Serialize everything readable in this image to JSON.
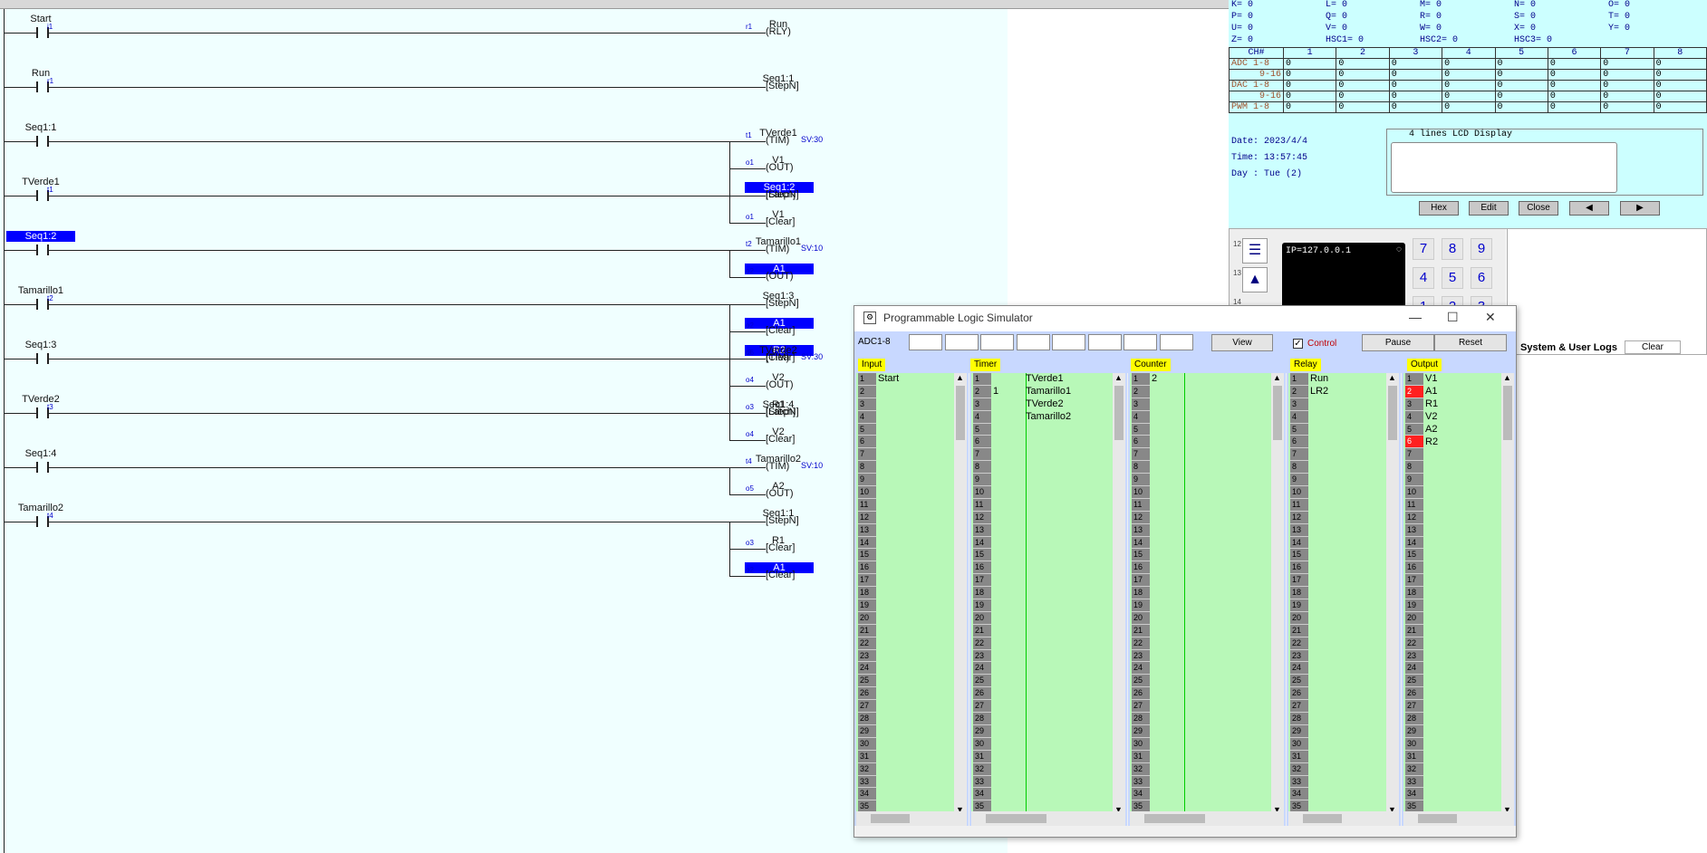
{
  "ladder": {
    "rungs": [
      {
        "contact": "Start",
        "contact_addr": "i1",
        "coils": [
          {
            "label": "Run",
            "addr": "r1",
            "type": "(RLY)"
          }
        ]
      },
      {
        "contact": "Run",
        "contact_addr": "r1",
        "coils": [
          {
            "label": "Seq1:1",
            "addr": "",
            "type": "[StepN]"
          }
        ]
      },
      {
        "contact": "Seq1:1",
        "contact_addr": "",
        "coils": [
          {
            "label": "TVerde1",
            "addr": "t1",
            "type": "(TIM)",
            "sv": "SV:30"
          },
          {
            "label": "V1",
            "addr": "o1",
            "type": "(OUT)"
          },
          {
            "label": "R2",
            "addr": "o6",
            "type": "[Latch]",
            "hl": true
          }
        ]
      },
      {
        "contact": "TVerde1",
        "contact_addr": "t1",
        "coils": [
          {
            "label": "Seq1:2",
            "addr": "",
            "type": "[StepN]",
            "hl": true
          },
          {
            "label": "V1",
            "addr": "o1",
            "type": "[Clear]"
          }
        ]
      },
      {
        "contact": "Seq1:2",
        "contact_addr": "",
        "contact_hl": true,
        "coils": [
          {
            "label": "Tamarillo1",
            "addr": "t2",
            "type": "(TIM)",
            "sv": "SV:10"
          },
          {
            "label": "A1",
            "addr": "o2",
            "type": "(OUT)",
            "hl": true
          }
        ]
      },
      {
        "contact": "Tamarillo1",
        "contact_addr": "t2",
        "coils": [
          {
            "label": "Seq1:3",
            "addr": "",
            "type": "[StepN]"
          },
          {
            "label": "A1",
            "addr": "o2",
            "type": "[Clear]",
            "hl": true
          },
          {
            "label": "R2",
            "addr": "o6",
            "type": "[Clear]",
            "hl": true
          }
        ]
      },
      {
        "contact": "Seq1:3",
        "contact_addr": "",
        "coils": [
          {
            "label": "TVerde2",
            "addr": "t3",
            "type": "(TIM)",
            "sv": "SV:30"
          },
          {
            "label": "V2",
            "addr": "o4",
            "type": "(OUT)"
          },
          {
            "label": "R1",
            "addr": "o3",
            "type": "[Latch]"
          }
        ]
      },
      {
        "contact": "TVerde2",
        "contact_addr": "t3",
        "coils": [
          {
            "label": "Seq1:4",
            "addr": "",
            "type": "[StepN]"
          },
          {
            "label": "V2",
            "addr": "o4",
            "type": "[Clear]"
          }
        ]
      },
      {
        "contact": "Seq1:4",
        "contact_addr": "",
        "coils": [
          {
            "label": "Tamarillo2",
            "addr": "t4",
            "type": "(TIM)",
            "sv": "SV:10"
          },
          {
            "label": "A2",
            "addr": "o5",
            "type": "(OUT)"
          }
        ]
      },
      {
        "contact": "Tamarillo2",
        "contact_addr": "t4",
        "coils": [
          {
            "label": "Seq1:1",
            "addr": "",
            "type": "[StepN]"
          },
          {
            "label": "R1",
            "addr": "o3",
            "type": "[Clear]"
          },
          {
            "label": "A1",
            "addr": "o2",
            "type": "[Clear]",
            "hl": true
          }
        ]
      }
    ]
  },
  "monitor": {
    "vars": [
      [
        "K= 0",
        "L= 0",
        "M= 0",
        "N= 0",
        "O= 0"
      ],
      [
        "P= 0",
        "Q= 0",
        "R= 0",
        "S= 0",
        "T= 0"
      ],
      [
        "U= 0",
        "V= 0",
        "W= 0",
        "X= 0",
        "Y= 0"
      ],
      [
        "Z= 0",
        "HSC1= 0",
        "HSC2= 0",
        "HSC3= 0",
        ""
      ]
    ],
    "ch_header": [
      "CH#",
      "1",
      "2",
      "3",
      "4",
      "5",
      "6",
      "7",
      "8"
    ],
    "ch_rows": [
      [
        "ADC 1-8",
        "0",
        "0",
        "0",
        "0",
        "0",
        "0",
        "0",
        "0"
      ],
      [
        "9-16",
        "0",
        "0",
        "0",
        "0",
        "0",
        "0",
        "0",
        "0"
      ],
      [
        "DAC 1-8",
        "0",
        "0",
        "0",
        "0",
        "0",
        "0",
        "0",
        "0"
      ],
      [
        "9-16",
        "0",
        "0",
        "0",
        "0",
        "0",
        "0",
        "0",
        "0"
      ],
      [
        "PWM 1-8",
        "0",
        "0",
        "0",
        "0",
        "0",
        "0",
        "0",
        "0"
      ]
    ],
    "date": "Date: 2023/4/4",
    "time": "Time: 13:57:45",
    "day": "Day : Tue (2)",
    "lcd_caption": "4 lines LCD Display",
    "buttons": {
      "hex": "Hex",
      "edit": "Edit",
      "close": "Close",
      "prev": "◀",
      "next": "▶"
    }
  },
  "keypad": {
    "ip": "IP=127.0.0.1",
    "keys": [
      "7",
      "8",
      "9",
      "4",
      "5",
      "6",
      "1",
      "2",
      "3"
    ],
    "row_nums": [
      "12",
      "13",
      "14"
    ],
    "logs_label": "System & User Logs",
    "clear": "Clear"
  },
  "sim": {
    "title": "Programmable Logic Simulator",
    "adc_label": "ADC1-8",
    "view": "View",
    "control": "Control",
    "pause": "Pause",
    "reset": "Reset",
    "headers": {
      "input": "Input",
      "timer": "Timer",
      "counter": "Counter",
      "relay": "Relay",
      "output": "Output"
    },
    "input_names": [
      "Start"
    ],
    "timer_names": [
      "TVerde1",
      "Tamarillo1",
      "TVerde2",
      "Tamarillo2"
    ],
    "timer_values": [
      "",
      "1"
    ],
    "counter_values": [
      "2"
    ],
    "relay_names": [
      "Run",
      "LR2"
    ],
    "output_names": [
      "V1",
      "A1",
      "R1",
      "V2",
      "A2",
      "R2"
    ],
    "output_on": [
      2,
      6
    ]
  }
}
